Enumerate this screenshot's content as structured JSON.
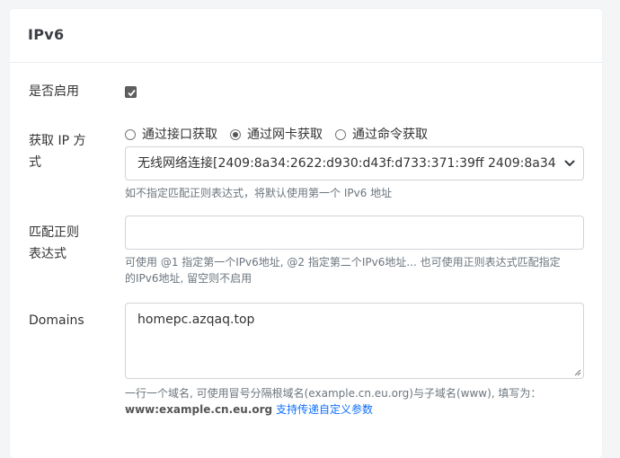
{
  "card": {
    "title": "IPv6"
  },
  "enable": {
    "label": "是否启用",
    "checked": true
  },
  "ip_method": {
    "label_line1": "获取 IP 方",
    "label_line2": "式",
    "options": [
      {
        "label": "通过接口获取",
        "checked": false
      },
      {
        "label": "通过网卡获取",
        "checked": true
      },
      {
        "label": "通过命令获取",
        "checked": false
      }
    ],
    "select_value": "无线网络连接[2409:8a34:2622:d930:d43f:d733:371:39ff 2409:8a34",
    "hint": "如不指定匹配正则表达式，将默认使用第一个 IPv6 地址"
  },
  "regex": {
    "label_line1": "匹配正则",
    "label_line2": "表达式",
    "value": "",
    "hint_line1": "可使用 @1 指定第一个IPv6地址, @2 指定第二个IPv6地址... 也可使用正则表达式匹配指定",
    "hint_line2": "的IPv6地址, 留空则不启用"
  },
  "domains": {
    "label": "Domains",
    "value": "homepc.azqaq.top",
    "hint_line1": "一行一个域名, 可使用冒号分隔根域名(example.cn.eu.org)与子域名(www), 填写为：",
    "hint_bold": "www:example.cn.eu.org",
    "hint_link": "支持传递自定义参数"
  },
  "colors": {
    "link": "#0d6efd",
    "hint": "#6c757d",
    "border": "#d0d3d8"
  }
}
